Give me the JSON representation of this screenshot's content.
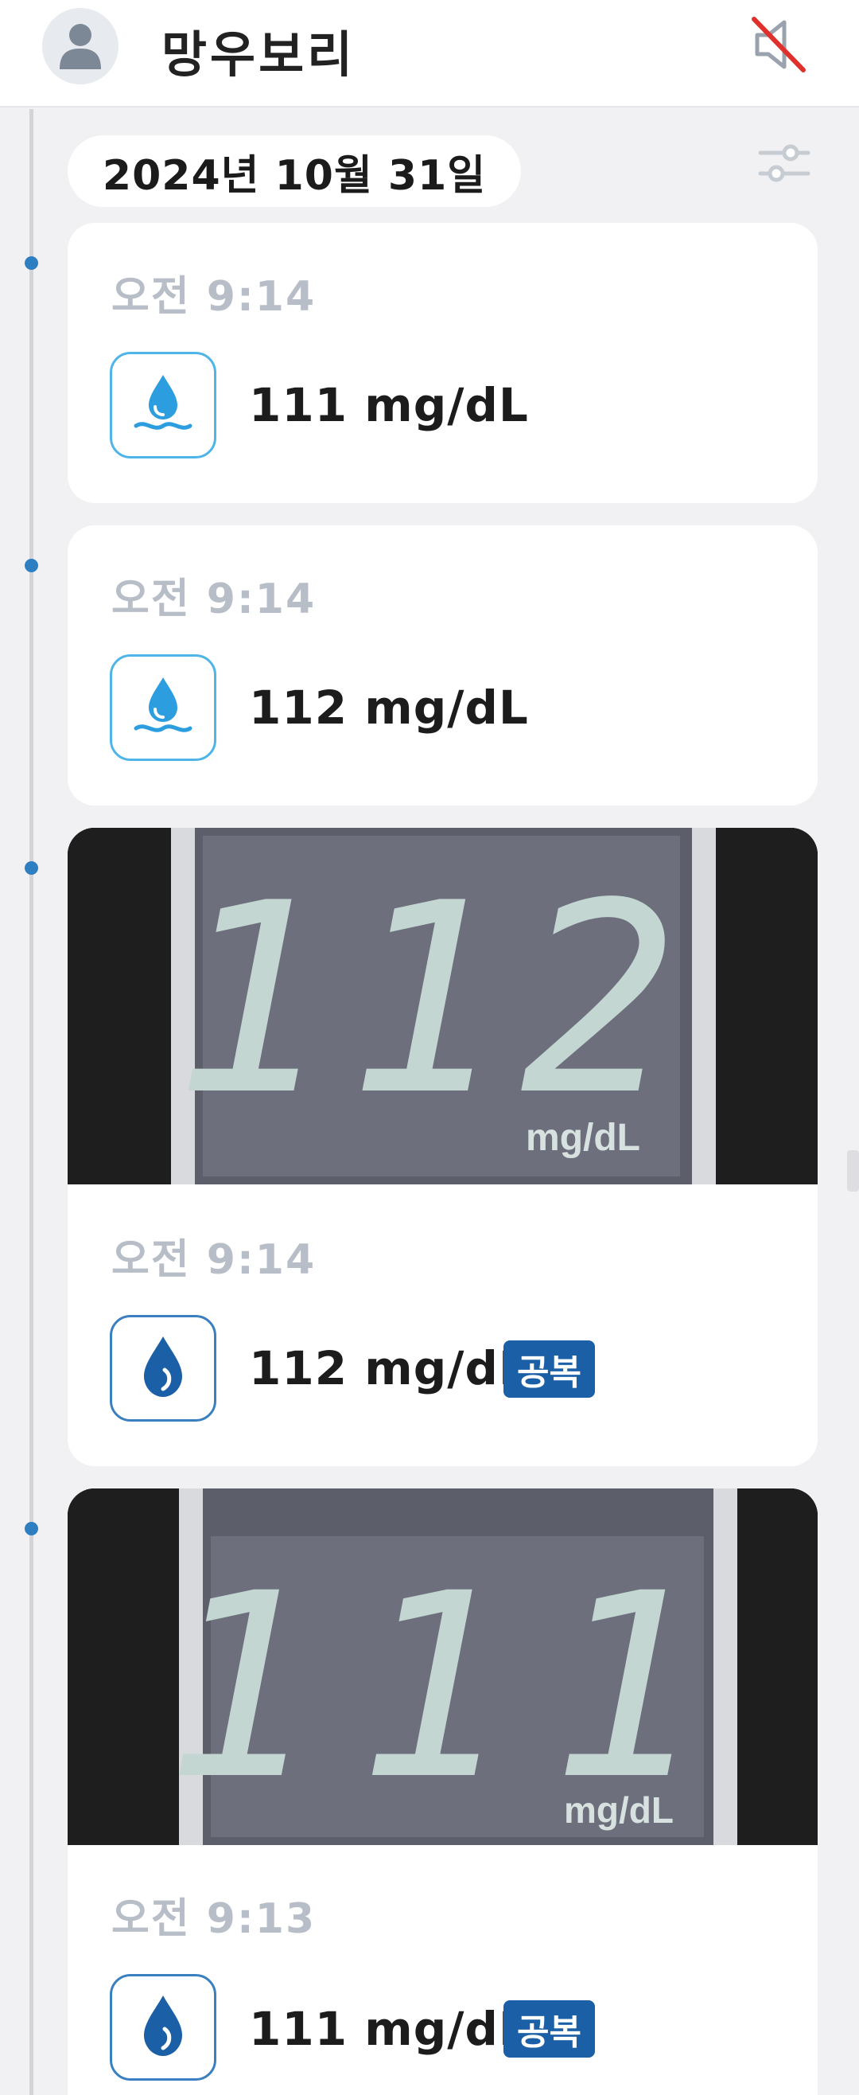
{
  "header": {
    "title": "망우보리",
    "avatar_icon": "person-icon",
    "mute_icon": "speaker-muted-icon"
  },
  "date_label": "2024년 10월 31일",
  "filter_icon": "sliders-icon",
  "colors": {
    "accent": "#2e7fc2",
    "badge": "#1b5fa6",
    "time_text": "#b8bec8",
    "mute_slash": "#e0302b"
  },
  "entries": [
    {
      "time": "오전 9:14",
      "value": "111 mg/dL",
      "icon": "water-drop-wave-icon",
      "badge": ""
    },
    {
      "time": "오전 9:14",
      "value": "112 mg/dL",
      "icon": "water-drop-wave-icon",
      "badge": ""
    },
    {
      "time": "오전 9:14",
      "value": "112 mg/dL",
      "icon": "blood-drop-icon",
      "badge": "공복",
      "photo": {
        "reading": "112",
        "unit": "mg/dL"
      }
    },
    {
      "time": "오전 9:13",
      "value": "111 mg/dL",
      "icon": "blood-drop-icon",
      "badge": "공복",
      "photo": {
        "reading": "111",
        "unit": "mg/dL"
      }
    }
  ]
}
